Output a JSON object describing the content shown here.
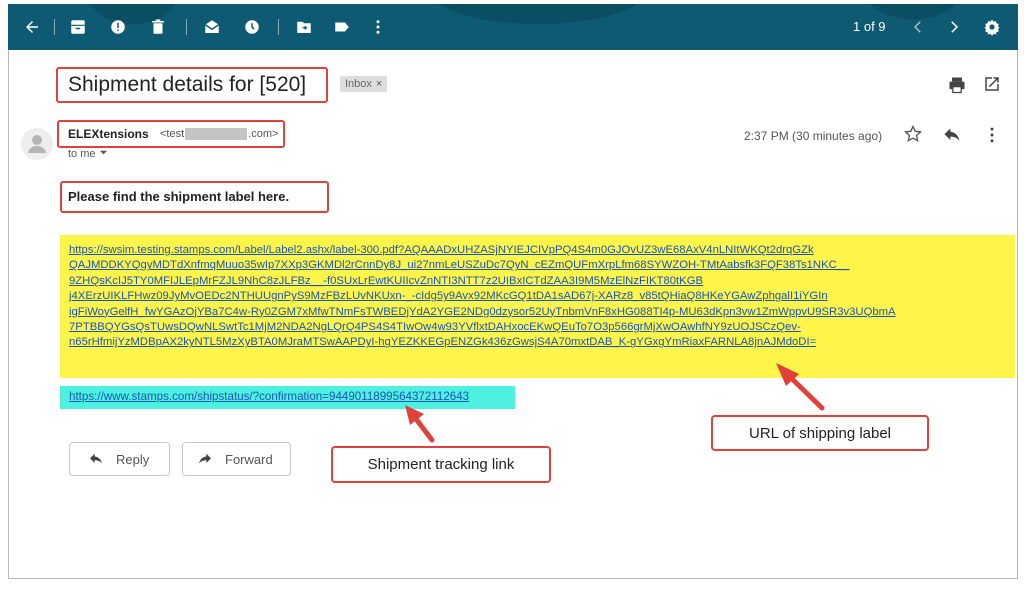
{
  "toolbar": {
    "icons": [
      "back-arrow-icon",
      "archive-icon",
      "report-spam-icon",
      "delete-icon",
      "mark-unread-icon",
      "snooze-icon",
      "move-to-icon",
      "label-icon",
      "more-vertical-icon"
    ],
    "page_count": "1 of 9",
    "colors": {
      "background": "#0f5a73"
    }
  },
  "email": {
    "subject": "Shipment details for [520]",
    "label_badge": "Inbox",
    "label_badge_close": "×",
    "sender": {
      "name": "ELEXtensions",
      "email_prefix": "<test",
      "email_suffix": ".com>"
    },
    "recipient": "to me",
    "timestamp": "2:37 PM (30 minutes ago)",
    "message": "Please find the shipment label here.",
    "label_url_lines": [
      "https://swsim.testing.stamps.com/Label/Label2.ashx/label-300.pdf?AQAAADxUHZASjNYIEJCIVpPQ4S4m0GJOvUZ3wE68AxV4nLNItWKQt2drqGZk",
      "QAJMDDKYQgyMDTdXnfmqMuuo35wIp7XXp3GKMDl2rCnnDy8J_ui27nmLeUSZuDc7QyN_cEZmQUFmXrpLfm68SYWZOH-TMtAabsfk3FQF38Ts1NKC__",
      "9ZHQsKcIJ5TY0MFIJLEpMrFZJL9NhC8zJLFBz__-f0SUxLrEwtKUIIcvZnNTI3NTT7z2UIBxICTdZAA3I9M5MzElNzFIKT80tKGB",
      "j4XErzUIKLFHwz09JyMvOEDc2NTHUUgnPyS9MzFBzLUvNKUxn-_-cIdg5y9Avx92MKcGQ1tDA1sAD67j-XARz8_v85tQHiaQ8HKeYGAwZphgalI1iYGIn",
      "igFiWoyGelfH_fwYGAzOjYBa7C4w-Ry0ZGM7xMfwTNmFsTWBEDjYdA2YGE2NDg0dzysor52UyTnbmVnF8xHG088TI4p-MU63dKpn3vw1ZmWppvU9SR3v3UQbmA",
      "7PTBBQYGsQsTUwsDQwNLSwtTc1MjM2NDA2NgLQrQ4PS4S4TIwOw4w93YVflxtDAHxocEKwQEuTo7O3p566grMjXwOAwhfNY9zUOJSCzQev-",
      "n65rHfmijYzMDBpAX2kyNTL5MzXyBTA0MJraMTSwAAPDyI-hgYEZKKEGpENZGk436zGwsjS4A70mxtDAB_K-gYGxgYmRiaxFARNLA8jnAJMdoDI="
    ],
    "tracking_link": "https://www.stamps.com/shipstatus/?confirmation=9449011899564372112643",
    "reply_label": "Reply",
    "forward_label": "Forward"
  },
  "callouts": {
    "shipping_label": "URL of shipping label",
    "tracking": "Shipment tracking link"
  },
  "colors": {
    "highlight_yellow": "#fff54a",
    "highlight_cyan": "#4ef0e2",
    "annotation_red": "#e0413b",
    "link_blue": "#1a55b8"
  }
}
